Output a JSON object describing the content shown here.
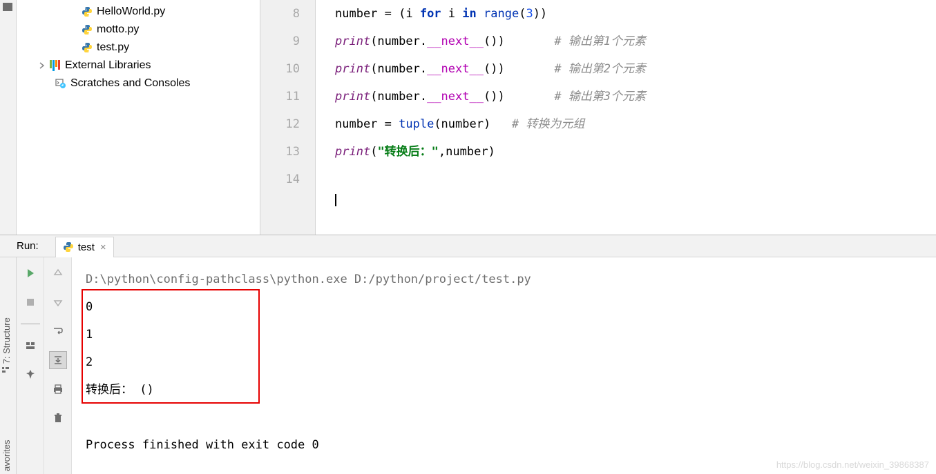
{
  "project_tree": {
    "files": [
      {
        "name": "HelloWorld.py"
      },
      {
        "name": "motto.py"
      },
      {
        "name": "test.py"
      }
    ],
    "external_libraries_label": "External Libraries",
    "scratches_label": "Scratches and Consoles"
  },
  "editor": {
    "lines": [
      {
        "num": "8"
      },
      {
        "num": "9"
      },
      {
        "num": "10"
      },
      {
        "num": "11"
      },
      {
        "num": "12"
      },
      {
        "num": "13"
      },
      {
        "num": "14"
      }
    ],
    "code": {
      "l8": {
        "a": "number = (i ",
        "for": "for",
        "b": " i ",
        "in": "in",
        "c": " ",
        "range": "range",
        "d": "(",
        "n3": "3",
        "e": "))"
      },
      "l9": {
        "print": "print",
        "a": "(number.",
        "dunder": "__next__",
        "b": "())       ",
        "comment": "# 输出第1个元素"
      },
      "l10": {
        "print": "print",
        "a": "(number.",
        "dunder": "__next__",
        "b": "())       ",
        "comment": "# 输出第2个元素"
      },
      "l11": {
        "print": "print",
        "a": "(number.",
        "dunder": "__next__",
        "b": "())       ",
        "comment": "# 输出第3个元素"
      },
      "l12": {
        "a": "number = ",
        "tuple": "tuple",
        "b": "(number)   ",
        "comment": "# 转换为元组"
      },
      "l13": {
        "print": "print",
        "a": "(",
        "str": "\"转换后：\"",
        "b": ",number)"
      }
    }
  },
  "run": {
    "label": "Run:",
    "tab_name": "test",
    "command": "D:\\python\\config-pathclass\\python.exe D:/python/project/test.py",
    "output": [
      "0",
      "1",
      "2",
      "转换后： ()"
    ],
    "exit_msg": "Process finished with exit code 0"
  },
  "side_labels": {
    "structure": "7: Structure",
    "favorites": "avorites"
  },
  "watermark": "https://blog.csdn.net/weixin_39868387"
}
